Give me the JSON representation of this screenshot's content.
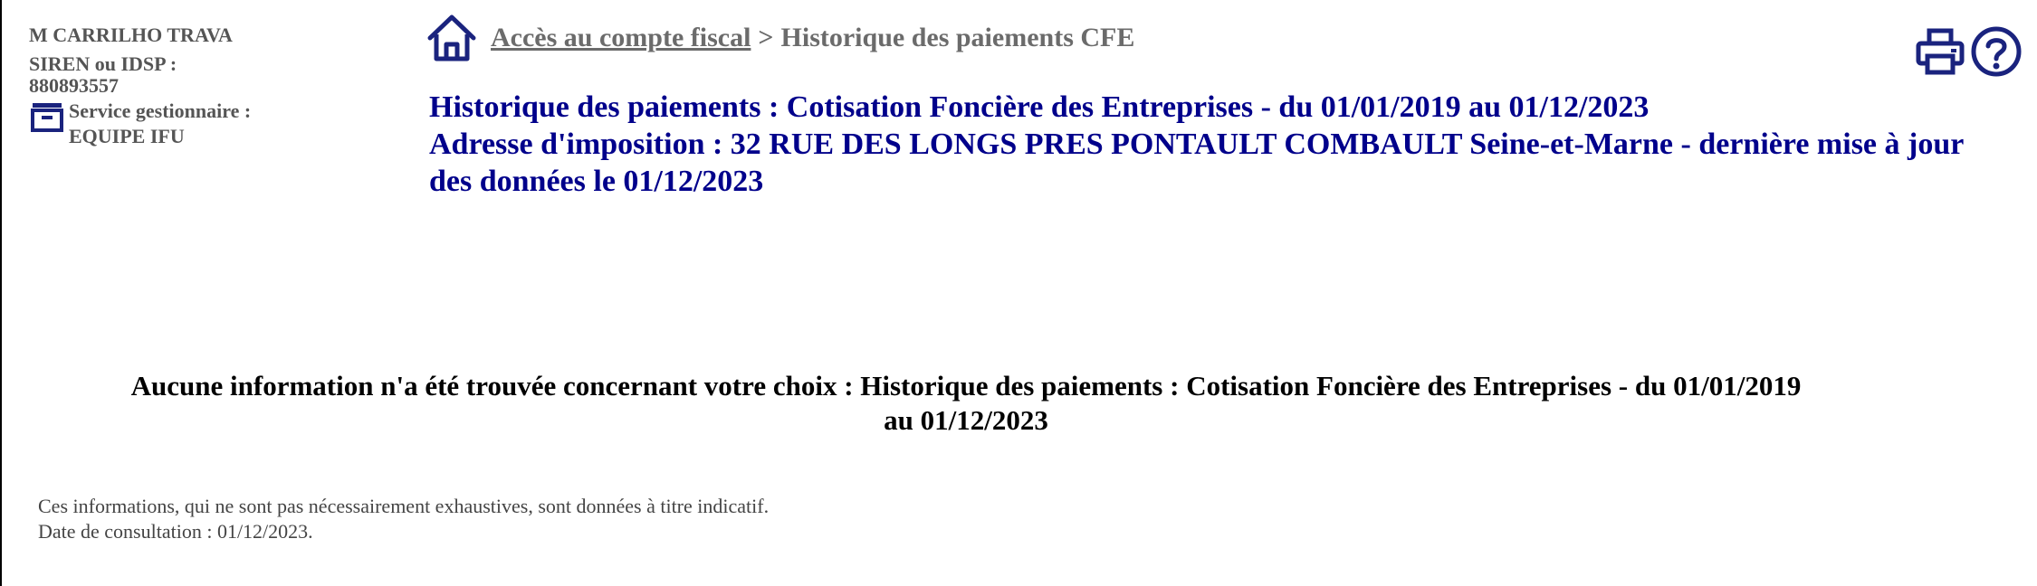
{
  "contributor": {
    "name": "M CARRILHO TRAVA",
    "siren_label": "SIREN ou IDSP :",
    "siren_value": "880893557",
    "service_label": "Service gestionnaire :",
    "service_value": "EQUIPE IFU",
    "service_icon": "service-drawer-icon"
  },
  "breadcrumb": {
    "home_icon": "home-icon",
    "link_label": "Accès au compte fiscal",
    "separator": ">",
    "current": "Historique des paiements CFE"
  },
  "tools": {
    "print_icon": "print-icon",
    "help_icon": "help-icon"
  },
  "titles": {
    "line1": "Historique des paiements : Cotisation Foncière des Entreprises - du 01/01/2019 au 01/12/2023",
    "line2": "Adresse d'imposition : 32 RUE DES LONGS PRES PONTAULT COMBAULT Seine-et-Marne - dernière mise à jour des données le 01/12/2023"
  },
  "message": {
    "text": "Aucune information n'a été trouvée concernant votre choix : Historique des paiements : Cotisation Foncière des Entreprises - du 01/01/2019 au 01/12/2023"
  },
  "notes": {
    "disclaimer": "Ces informations, qui ne sont pas nécessairement exhaustives, sont données à titre indicatif.",
    "consultation": "Date de consultation : 01/12/2023."
  },
  "colors": {
    "title_blue": "#00008b",
    "icon_blue": "#1a237e",
    "breadcrumb_gray": "#6b6b6b",
    "sidebar_gray": "#555555"
  }
}
